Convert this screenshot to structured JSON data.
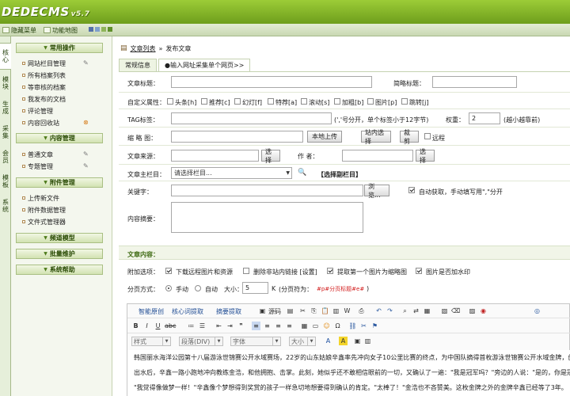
{
  "app": {
    "logo": "DEDECMS",
    "version": "v5.7"
  },
  "topbar": {
    "hide_menu": "隐藏菜单",
    "func_map": "功能地图",
    "swatch_colors": [
      "#5470a8",
      "#7e9fcc",
      "#8fb55a",
      "#5f8f2a"
    ]
  },
  "vtabs": [
    "核心",
    "模块",
    "生成",
    "采集",
    "会员",
    "模板",
    "系统"
  ],
  "sidebar": {
    "groups": [
      {
        "title": "常用操作",
        "items": [
          {
            "label": "网站栏目管理",
            "icon": "edit-icon"
          },
          {
            "label": "所有档案列表"
          },
          {
            "label": "等审核的档案"
          },
          {
            "label": "我发布的文档"
          },
          {
            "label": "评论管理"
          },
          {
            "label": "内容回收站",
            "icon": "recycle-icon"
          }
        ]
      },
      {
        "title": "内容管理",
        "items": [
          {
            "label": "普通文章",
            "icon": "edit-icon"
          },
          {
            "label": "专题管理",
            "icon": "edit-icon"
          }
        ]
      },
      {
        "title": "附件管理",
        "items": [
          {
            "label": "上传新文件"
          },
          {
            "label": "附件数据管理"
          },
          {
            "label": "文件式管理器"
          }
        ]
      },
      {
        "title": "频道模型",
        "items": []
      },
      {
        "title": "批量维护",
        "items": []
      },
      {
        "title": "系统帮助",
        "items": []
      }
    ]
  },
  "breadcrumb": {
    "list": "文章列表",
    "sep": "»",
    "current": "发布文章"
  },
  "tabs": [
    "常规信息",
    "●输入网址采集单个网页>>"
  ],
  "form": {
    "title_label": "文章标题：",
    "short_title_label": "简略标题：",
    "attr_label": "自定义属性：",
    "attrs": [
      "头条[h]",
      "推荐[c]",
      "幻灯[f]",
      "特荐[a]",
      "滚动[s]",
      "加粗[b]",
      "图片[p]",
      "跳转[j]"
    ],
    "tag_label": "TAG标签：",
    "tag_hint": "(','号分开，单个标签小于12字节)",
    "weight_label": "权重：",
    "weight_value": "2",
    "weight_hint": "(越小越靠前)",
    "thumb_label": "缩 略 图：",
    "local_upload": "本地上传",
    "site_select": "站内选择",
    "crop": "裁剪",
    "remote": "远程",
    "source_label": "文章来源：",
    "choose": "选择",
    "author_label": "作  者：",
    "column_label": "文章主栏目：",
    "column_placeholder": "请选择栏目...",
    "sub_column": "【选择副栏目】",
    "keywords_label": "关键字：",
    "browse": "浏览...",
    "auto_keywords": "自动获取，手动填写用\",\"分开",
    "summary_label": "内容摘要："
  },
  "content_section": {
    "title": "文章内容："
  },
  "options": {
    "label": "附加选项：",
    "items": [
      "下载远程图片和资源",
      "删除非站内链接 [设置]",
      "提取第一个图片为缩略图",
      "图片是否加水印"
    ],
    "checked": [
      true,
      false,
      true,
      true
    ]
  },
  "paging": {
    "label": "分页方式：",
    "manual": "手动",
    "auto": "自动",
    "size_label": "大小：",
    "size_value": "5",
    "unit": "K",
    "sep_text": "(分页符为：",
    "sep_marker": "#p#分页标题#e#",
    "sep_end": ")"
  },
  "editor": {
    "plugins": [
      "智能原创",
      "核心词提取",
      "摘要提取"
    ],
    "source_label": "源码",
    "style_select": "样式",
    "format_select": "段落(DIV)",
    "font_select": "字体",
    "size_select": "大小",
    "lines": [
      "韩国丽水海洋公园第十八届游泳世锦赛公开水域赛场，22岁的山东姑娘辛鑫率先冲向女子10公里比赛的终点，为中国队摘得首枚游泳世锦赛公开水域金牌，创",
      "出水后，辛鑫一路小跑地冲向教练金浩，和他拥抱、击掌。此刻，她似乎还不敢相信眼前的一切，又确认了一遍：\"我是冠军吗？\"旁边的人说：\"是的，你是冠",
      "\"我觉得像做梦一样！\"辛鑫像个梦想得到奖赏的孩子一样急切地想要得到确认的肯定。\"太棒了！\"金浩也不吝赞美。这枚金牌之外的金牌辛鑫已经等了3年。"
    ]
  }
}
